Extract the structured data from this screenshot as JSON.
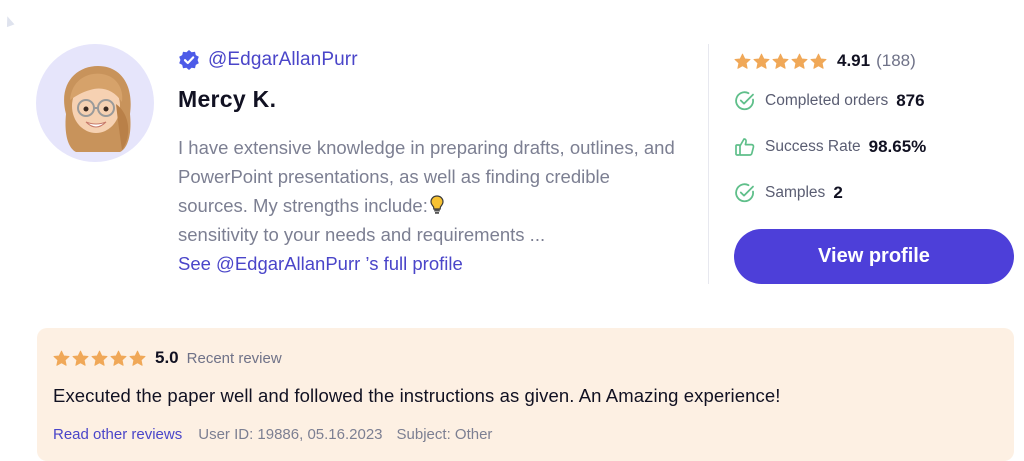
{
  "writer": {
    "handle": "@EdgarAllanPurr",
    "name": "Mercy K.",
    "bio": "I have extensive knowledge in preparing drafts, outlines, and PowerPoint presentations, as well as finding credible sources. My strengths include:",
    "bio_tail": "sensitivity to your needs and requirements ...",
    "profile_link": "See @EdgarAllanPurr ’s full profile",
    "rating": "4.91",
    "rating_count": "(188)",
    "stars": 5,
    "stats": [
      {
        "icon": "check-circle-icon",
        "label": "Completed orders",
        "value": "876"
      },
      {
        "icon": "thumbs-up-icon",
        "label": "Success Rate",
        "value": "98.65%"
      },
      {
        "icon": "check-circle-icon",
        "label": "Samples",
        "value": "2"
      }
    ],
    "view_button": "View profile"
  },
  "review": {
    "score": "5.0",
    "stars": 5,
    "tag": "Recent review",
    "text": "Executed the paper well and followed the instructions as given. An Amazing experience!",
    "read_link": "Read other reviews",
    "user_info": "User ID: 19886, 05.16.2023",
    "subject": "Subject: Other"
  },
  "colors": {
    "accent": "#4d3fd9",
    "link": "#4a45c9",
    "star": "#f0a858",
    "check": "#5fbf8a",
    "review_bg": "#fdf0e3",
    "avatar_bg": "#e6e5fb"
  }
}
